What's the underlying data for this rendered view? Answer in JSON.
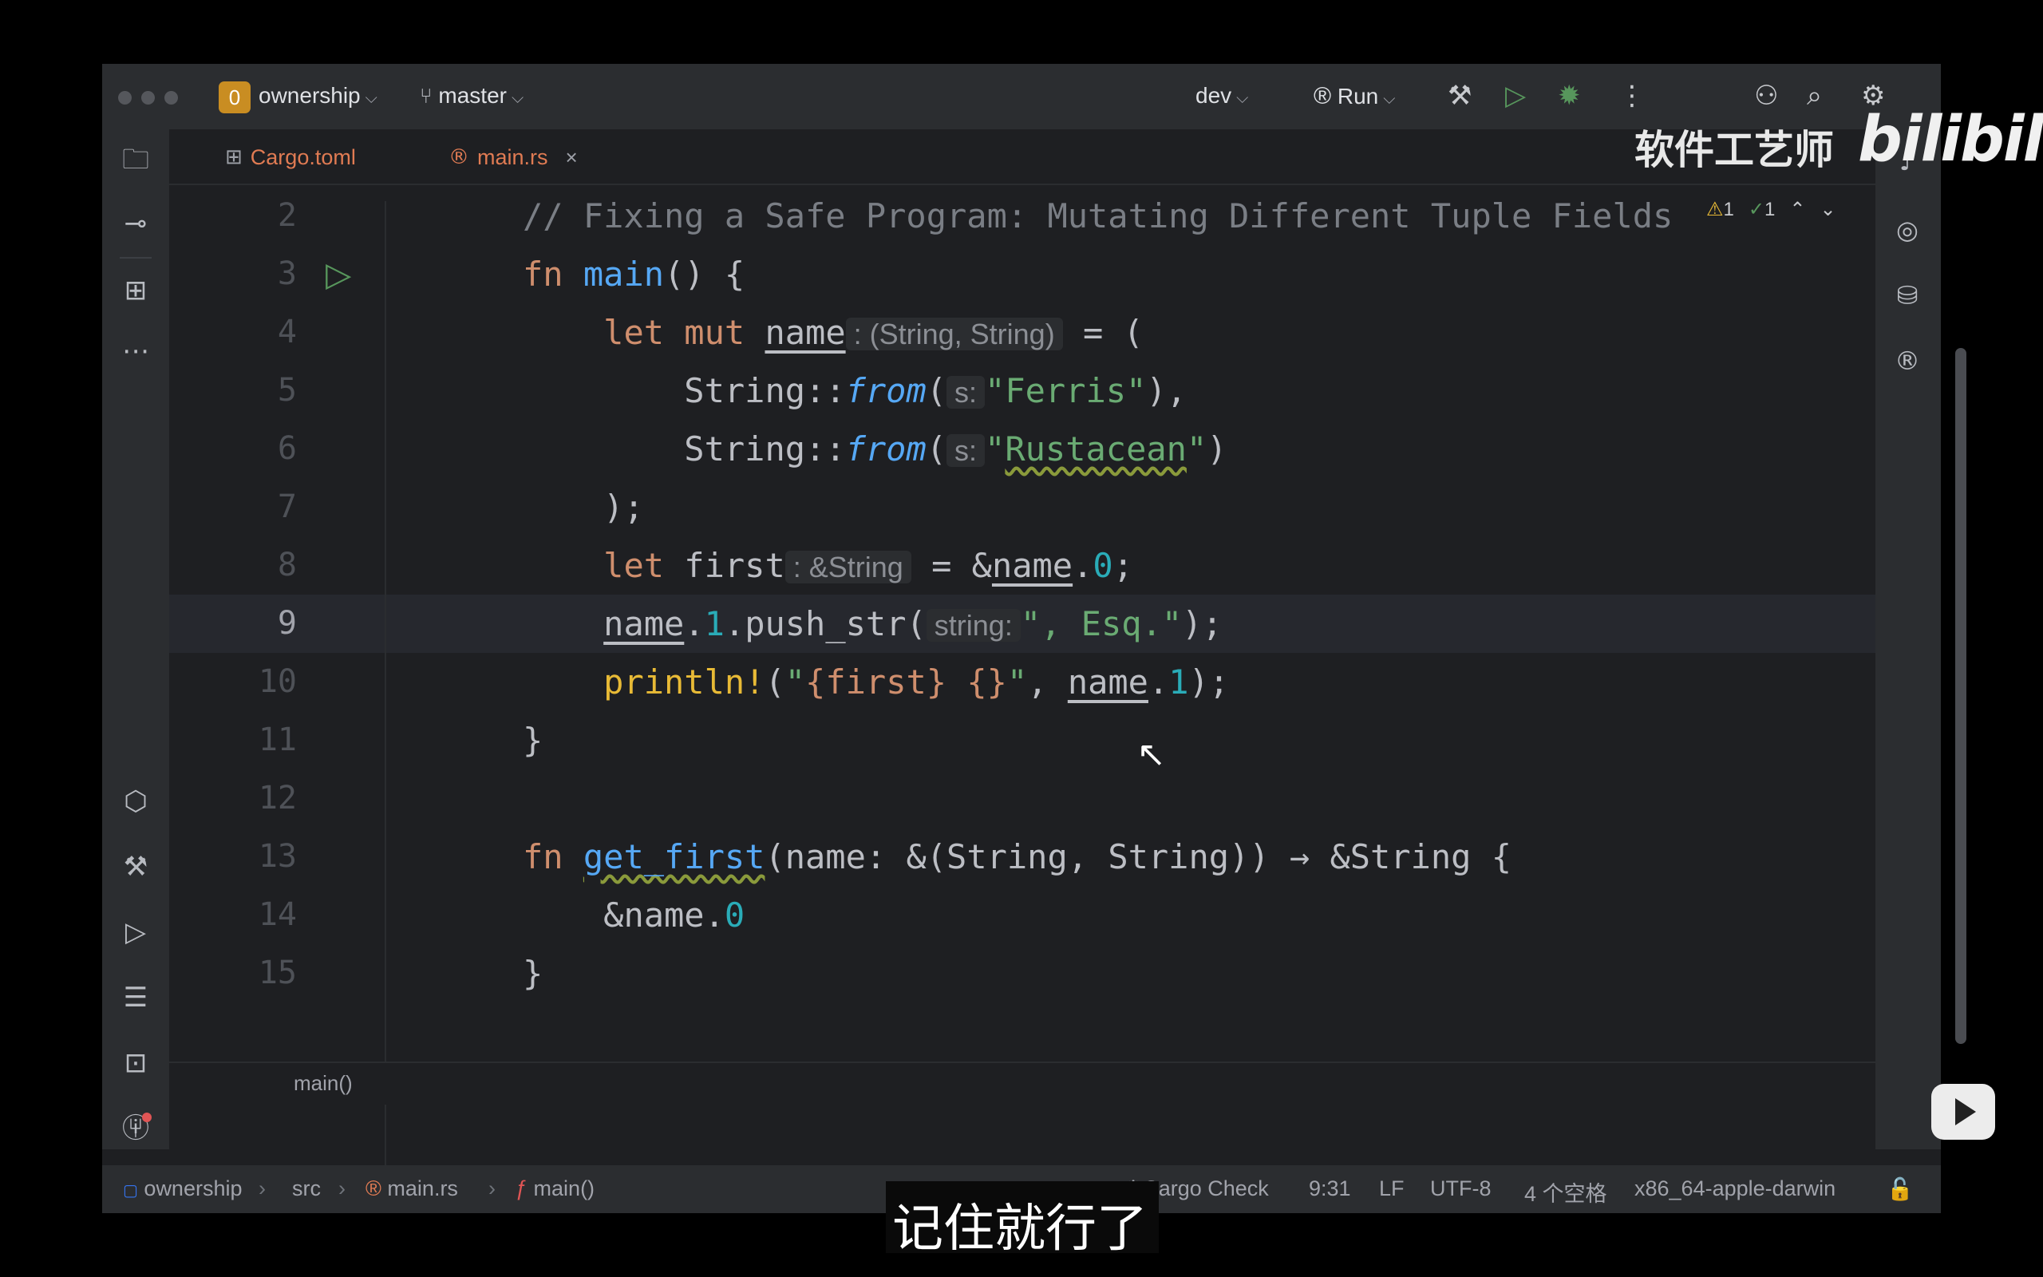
{
  "titlebar": {
    "project_badge": "0",
    "project_name": "ownership",
    "branch": "master",
    "run_config": "dev",
    "run_label": "Run"
  },
  "tabs": [
    {
      "label": "Cargo.toml",
      "active": false
    },
    {
      "label": "main.rs",
      "active": true,
      "close": "×"
    }
  ],
  "inspections": {
    "warnings": "1",
    "weak_warnings": "1"
  },
  "editor": {
    "lines": [
      {
        "num": "2"
      },
      {
        "num": "3"
      },
      {
        "num": "4"
      },
      {
        "num": "5"
      },
      {
        "num": "6"
      },
      {
        "num": "7"
      },
      {
        "num": "8"
      },
      {
        "num": "9"
      },
      {
        "num": "10"
      },
      {
        "num": "11"
      },
      {
        "num": "12"
      },
      {
        "num": "13"
      },
      {
        "num": "14"
      },
      {
        "num": "15"
      }
    ],
    "current_line": "9",
    "code": {
      "l2_comment": "// Fixing a Safe Program: Mutating Different Tuple Fields",
      "l3_fn": "fn",
      "l3_main": "main",
      "l3_rest": "() {",
      "l4_let": "let mut",
      "l4_name": "name",
      "l4_hint": ": (String, String)",
      "l4_rest": " = (",
      "l5_type": "String::",
      "l5_from": "from",
      "l5_paren": "(",
      "l5_hint": "s:",
      "l5_str": "\"Ferris\"",
      "l5_rest": "),",
      "l6_type": "String::",
      "l6_from": "from",
      "l6_paren": "(",
      "l6_hint": "s:",
      "l6_q1": "\"",
      "l6_str": "Rustacean",
      "l6_q2": "\"",
      "l6_rest": ")",
      "l7": ");",
      "l8_let": "let",
      "l8_first": " first",
      "l8_hint": ": &String",
      "l8_eq": " = &",
      "l8_name": "name",
      "l8_dot": ".",
      "l8_num": "0",
      "l8_semi": ";",
      "l9_name": "name",
      "l9_dot": ".",
      "l9_num": "1",
      "l9_call": ".push_str(",
      "l9_hint": "string:",
      "l9_str": "\", Esq.\"",
      "l9_rest": ");",
      "l10_mac": "println!",
      "l10_paren": "(",
      "l10_str1": "\"",
      "l10_interp": "{first}",
      "l10_space": " ",
      "l10_interp2": "{}",
      "l10_str2": "\"",
      "l10_comma": ", ",
      "l10_name": "name",
      "l10_dot": ".",
      "l10_num": "1",
      "l10_rest": ");",
      "l11": "}",
      "l13_fn": "fn",
      "l13_name": "get_first",
      "l13_rest": "(name: &(String, String)) → &String {",
      "l14_pre": "&name.",
      "l14_num": "0",
      "l15": "}"
    }
  },
  "breadcrumb_editor": "main()",
  "statusbar": {
    "project": "ownership",
    "src": "src",
    "file": "main.rs",
    "fn": "main()",
    "cargo_check": "Cargo Check",
    "position": "9:31",
    "line_sep": "LF",
    "encoding": "UTF-8",
    "indent": "4 个空格",
    "target": "x86_64-apple-darwin"
  },
  "overlay": {
    "watermark_text": "软件工艺师",
    "watermark_logo": "bilibili",
    "subtitle": "记住就行了"
  },
  "colors": {
    "keyword": "#cf8e6d",
    "function": "#56a8f5",
    "string": "#6aab73",
    "number": "#2aacb8",
    "comment": "#7a7e85",
    "macro": "#e8ba36",
    "accent": "#3574f0"
  }
}
